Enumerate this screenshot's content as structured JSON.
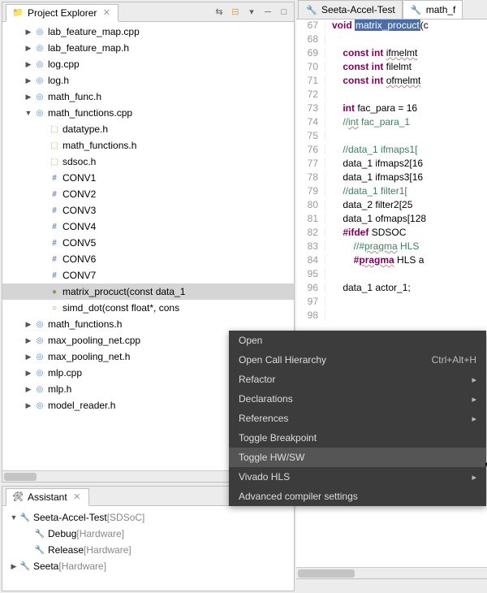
{
  "explorer": {
    "title": "Project Explorer",
    "items": [
      {
        "ind": 1,
        "tri": "closed",
        "ic": "cpp",
        "name": "lab_feature_map.cpp"
      },
      {
        "ind": 1,
        "tri": "closed",
        "ic": "h",
        "name": "lab_feature_map.h"
      },
      {
        "ind": 1,
        "tri": "closed",
        "ic": "cpp",
        "name": "log.cpp"
      },
      {
        "ind": 1,
        "tri": "closed",
        "ic": "h",
        "name": "log.h"
      },
      {
        "ind": 1,
        "tri": "closed",
        "ic": "h",
        "name": "math_func.h"
      },
      {
        "ind": 1,
        "tri": "open",
        "ic": "cpp",
        "name": "math_functions.cpp"
      },
      {
        "ind": 2,
        "tri": "none",
        "ic": "outline",
        "name": "datatype.h"
      },
      {
        "ind": 2,
        "tri": "none",
        "ic": "outline",
        "name": "math_functions.h"
      },
      {
        "ind": 2,
        "tri": "none",
        "ic": "outline",
        "name": "sdsoc.h"
      },
      {
        "ind": 2,
        "tri": "none",
        "ic": "hash",
        "name": "CONV1"
      },
      {
        "ind": 2,
        "tri": "none",
        "ic": "hash",
        "name": "CONV2"
      },
      {
        "ind": 2,
        "tri": "none",
        "ic": "hash",
        "name": "CONV3"
      },
      {
        "ind": 2,
        "tri": "none",
        "ic": "hash",
        "name": "CONV4"
      },
      {
        "ind": 2,
        "tri": "none",
        "ic": "hash",
        "name": "CONV5"
      },
      {
        "ind": 2,
        "tri": "none",
        "ic": "hash",
        "name": "CONV6"
      },
      {
        "ind": 2,
        "tri": "none",
        "ic": "hash",
        "name": "CONV7"
      },
      {
        "ind": 2,
        "tri": "none",
        "ic": "method",
        "name": "matrix_procuct(const data_1",
        "sel": true
      },
      {
        "ind": 2,
        "tri": "none",
        "ic": "dot",
        "name": "simd_dot(const float*, cons"
      },
      {
        "ind": 1,
        "tri": "closed",
        "ic": "h",
        "name": "math_functions.h"
      },
      {
        "ind": 1,
        "tri": "closed",
        "ic": "cpp",
        "name": "max_pooling_net.cpp"
      },
      {
        "ind": 1,
        "tri": "closed",
        "ic": "h",
        "name": "max_pooling_net.h"
      },
      {
        "ind": 1,
        "tri": "closed",
        "ic": "cpp",
        "name": "mlp.cpp"
      },
      {
        "ind": 1,
        "tri": "closed",
        "ic": "h",
        "name": "mlp.h"
      },
      {
        "ind": 1,
        "tri": "closed",
        "ic": "h",
        "name": "model_reader.h"
      }
    ]
  },
  "assistant": {
    "title": "Assistant",
    "items": [
      {
        "tri": "open",
        "name": "Seeta-Accel-Test",
        "bracket": "[SDSoC]"
      },
      {
        "tri": "none",
        "name": "Debug",
        "bracket": "[Hardware]",
        "ind": 1
      },
      {
        "tri": "none",
        "name": "Release",
        "bracket": "[Hardware]",
        "ind": 1
      },
      {
        "tri": "closed",
        "name": "Seeta",
        "bracket": "[Hardware]"
      }
    ]
  },
  "editor": {
    "tabs": [
      {
        "label": "Seeta-Accel-Test",
        "active": false
      },
      {
        "label": "math_f",
        "active": true
      }
    ],
    "lines": [
      {
        "n": 67,
        "html": "<span class='kw'>void</span> <span class='sel'>matrix_procuct</span>(c"
      },
      {
        "n": 68,
        "html": ""
      },
      {
        "n": 69,
        "html": "    <span class='kw'>const int</span> <span class='under'>ifmelmt</span>"
      },
      {
        "n": 70,
        "html": "    <span class='kw'>const int</span> filelmt"
      },
      {
        "n": 71,
        "html": "    <span class='kw'>const int</span> <span class='under'>ofmelmt</span>"
      },
      {
        "n": 72,
        "html": ""
      },
      {
        "n": 73,
        "html": "    <span class='kw'>int</span> fac_para = 16"
      },
      {
        "n": 74,
        "html": "    <span class='cm'>//<span class='under'>int</span> fac_para_1 </span>"
      },
      {
        "n": 75,
        "html": ""
      },
      {
        "n": 76,
        "html": "    <span class='cm'>//data_1 ifmaps1[</span>"
      },
      {
        "n": 77,
        "html": "    data_1 ifmaps2[16"
      },
      {
        "n": 78,
        "html": "    data_1 ifmaps3[16"
      },
      {
        "n": 79,
        "html": "    <span class='cm'>//data_1 filter1[</span>"
      },
      {
        "n": 80,
        "html": "    data_2 filter2[25"
      },
      {
        "n": 81,
        "html": "    data_1 ofmaps[128"
      },
      {
        "n": 82,
        "html": "    <span class='pp'>#ifdef</span> SDSOC"
      },
      {
        "n": 83,
        "html": "        <span class='cm'>//#<span class='under'>pragma</span> HLS</span>"
      },
      {
        "n": 84,
        "html": "        <span class='pp'>#<span class='under'>pragma</span></span> HLS a"
      },
      {
        "n": 95,
        "html": ""
      },
      {
        "n": 96,
        "html": "    data_1 actor_1;"
      },
      {
        "n": 97,
        "html": ""
      },
      {
        "n": 98,
        "html": ""
      }
    ]
  },
  "context_menu": [
    {
      "label": "Open"
    },
    {
      "label": "Open Call Hierarchy",
      "shortcut": "Ctrl+Alt+H"
    },
    {
      "label": "Refactor",
      "sub": true
    },
    {
      "label": "Declarations",
      "sub": true
    },
    {
      "label": "References",
      "sub": true
    },
    {
      "label": "Toggle Breakpoint"
    },
    {
      "label": "Toggle HW/SW",
      "hl": true
    },
    {
      "label": "Vivado HLS",
      "sub": true
    },
    {
      "label": "Advanced compiler settings"
    }
  ]
}
